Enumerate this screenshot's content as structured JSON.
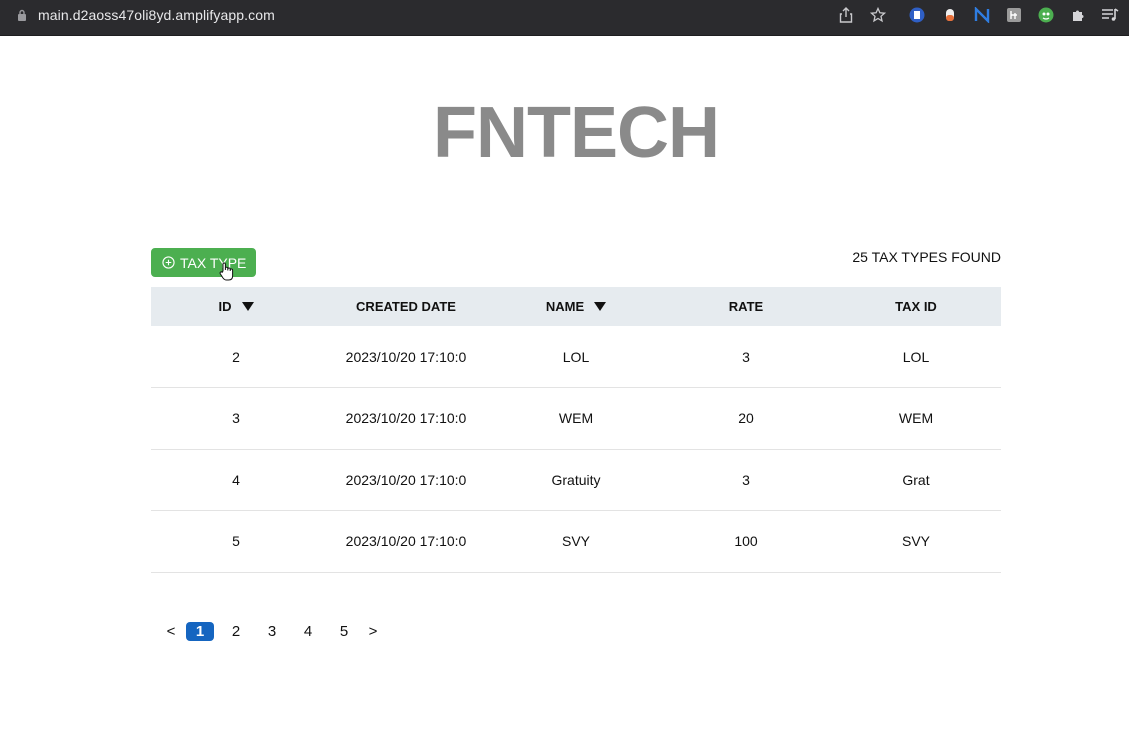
{
  "browser": {
    "url": "main.d2aoss47oli8yd.amplifyapp.com"
  },
  "page": {
    "brand": "FNTECH",
    "add_button_label": "TAX TYPE",
    "found_text": "25 TAX TYPES FOUND"
  },
  "table": {
    "headers": {
      "id": "ID",
      "created": "CREATED DATE",
      "name": "NAME",
      "rate": "RATE",
      "tax_id": "TAX ID"
    },
    "rows": [
      {
        "id": "2",
        "created": "2023/10/20 17:10:0",
        "name": "LOL",
        "rate": "3",
        "tax_id": "LOL"
      },
      {
        "id": "3",
        "created": "2023/10/20 17:10:0",
        "name": "WEM",
        "rate": "20",
        "tax_id": "WEM"
      },
      {
        "id": "4",
        "created": "2023/10/20 17:10:0",
        "name": "Gratuity",
        "rate": "3",
        "tax_id": "Grat"
      },
      {
        "id": "5",
        "created": "2023/10/20 17:10:0",
        "name": "SVY",
        "rate": "100",
        "tax_id": "SVY"
      }
    ]
  },
  "pagination": {
    "prev": "<",
    "next": ">",
    "pages": [
      "1",
      "2",
      "3",
      "4",
      "5"
    ],
    "current": "1"
  },
  "colors": {
    "add_button": "#4caf50",
    "active_page": "#1565c0",
    "brand": "#8a8a8a",
    "header_bg": "#e6ebef"
  },
  "icons": [
    "lock-icon",
    "share-icon",
    "star-icon",
    "extension-doc-icon",
    "extension-pill-icon",
    "extension-n-icon",
    "extension-gray-icon",
    "extension-green-icon",
    "puzzle-icon",
    "reading-list-icon",
    "plus-circle-icon",
    "hand-cursor-icon",
    "sort-down-icon"
  ]
}
